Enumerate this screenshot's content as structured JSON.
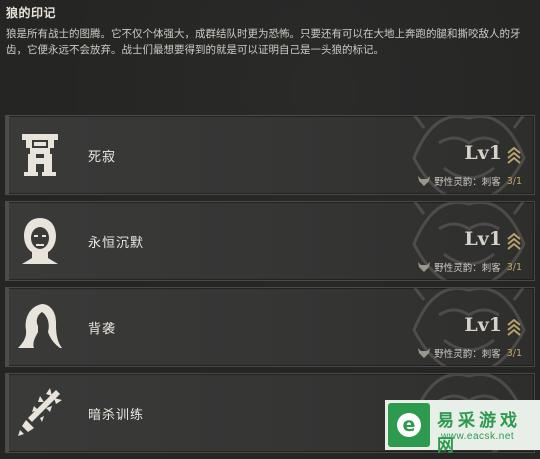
{
  "header": {
    "title": "狼的印记",
    "description": "狼是所有战士的图腾。它不仅个体强大，成群结队时更为恐怖。只要还有可以在大地上奔跑的腿和撕咬敌人的牙齿，它便永远不会放弃。战士们最想要得到的就是可以证明自己是一头狼的标记。"
  },
  "skills": [
    {
      "name": "死寂",
      "level": "Lv1",
      "requirement": "野性灵韵：刺客",
      "count": "3/1",
      "icon": "tower-helm-icon"
    },
    {
      "name": "永恒沉默",
      "level": "Lv1",
      "requirement": "野性灵韵：刺客",
      "count": "3/1",
      "icon": "hooded-face-icon"
    },
    {
      "name": "背袭",
      "level": "Lv1",
      "requirement": "野性灵韵：刺客",
      "count": "3/1",
      "icon": "hooded-figure-icon"
    },
    {
      "name": "暗杀训练",
      "level": "",
      "requirement": "",
      "count": "",
      "icon": "spiked-sword-icon"
    }
  ],
  "watermark": {
    "logo_letter": "e",
    "brand": "易采游戏网",
    "url": "www.eacsk.net"
  },
  "colors": {
    "background": "#252524",
    "card": "#383837",
    "text": "#ece8e0",
    "count": "#c9a66b",
    "chevron": "#b8a36a",
    "watermark_green": "#2d9a4e"
  }
}
